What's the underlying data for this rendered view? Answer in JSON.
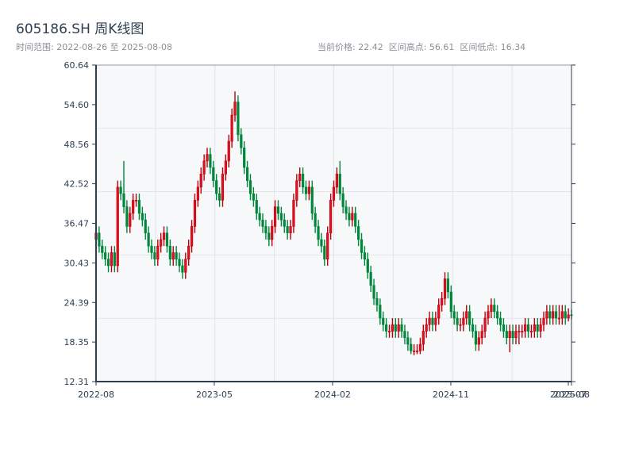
{
  "header": {
    "title": "605186.SH 周K线图",
    "range_label": "时间范围: 2022-08-26 至 2025-08-08",
    "current_price_label": "当前价格: 22.42",
    "high_label": "区间高点: 56.61",
    "low_label": "区间低点: 16.34"
  },
  "chart_data": {
    "type": "candlestick",
    "title": "605186.SH 周K线图",
    "frequency": "weekly",
    "date_range": [
      "2022-08-26",
      "2025-08-08"
    ],
    "ylim": [
      12.31,
      60.64
    ],
    "y_ticks": [
      "60.64",
      "54.60",
      "48.56",
      "42.52",
      "36.47",
      "30.43",
      "24.39",
      "18.35",
      "12.31"
    ],
    "x_ticks": [
      "2022-08",
      "2023-05",
      "2024-02",
      "2024-11",
      "2025-07",
      "2025-08"
    ],
    "grid": true,
    "colors": {
      "up": "#e3101e",
      "up_border": "#b8000d",
      "down": "#00873c",
      "background": "#f7f8fa",
      "axis": "#2d3e50",
      "grid": "#e1e4ea"
    },
    "open": [
      34,
      35,
      33,
      32,
      31,
      30,
      32,
      30,
      42,
      41,
      39,
      36,
      38,
      40,
      40,
      38,
      37,
      35,
      33,
      32,
      31,
      33,
      34,
      35,
      33,
      31,
      32,
      31,
      30,
      29,
      31,
      33,
      36,
      40,
      42,
      44,
      46,
      47,
      45,
      43,
      41,
      40,
      44,
      46,
      49,
      53,
      55,
      50,
      48,
      45,
      43,
      41,
      40,
      38,
      37,
      36,
      35,
      34,
      36,
      39,
      38,
      37,
      36,
      35,
      36,
      40,
      43,
      44,
      42,
      41,
      42,
      38,
      36,
      34,
      33,
      31,
      35,
      40,
      42,
      44,
      41,
      39,
      38,
      37,
      38,
      36,
      34,
      32,
      31,
      29,
      27,
      25,
      24,
      22,
      21,
      20,
      20,
      21,
      20,
      21,
      20,
      19,
      18,
      17,
      17,
      17,
      18,
      20,
      21,
      22,
      21,
      22,
      24,
      25,
      28,
      26,
      23,
      22,
      21,
      21,
      22,
      23,
      21,
      20,
      18,
      19,
      20,
      22,
      23,
      24,
      23,
      22,
      21,
      20,
      19,
      20,
      19,
      20,
      20,
      20,
      21,
      20,
      20,
      21,
      20,
      21,
      22,
      23,
      22,
      23,
      22,
      22,
      23,
      22,
      22.5
    ],
    "high": [
      36,
      36,
      34,
      33,
      32,
      33,
      33,
      43,
      43,
      46,
      40,
      39,
      41,
      41,
      41,
      39,
      38,
      36,
      34,
      33,
      34,
      35,
      36,
      36,
      34,
      33,
      33,
      32,
      31,
      32,
      34,
      37,
      41,
      43,
      45,
      47,
      48,
      48,
      46,
      44,
      42,
      45,
      47,
      50,
      54,
      56.61,
      56,
      51,
      49,
      46,
      44,
      42,
      41,
      39,
      38,
      37,
      36,
      37,
      40,
      40,
      39,
      38,
      37,
      37,
      41,
      44,
      45,
      45,
      43,
      43,
      43,
      39,
      37,
      35,
      34,
      36,
      41,
      43,
      45,
      46,
      42,
      40,
      39,
      39,
      39,
      37,
      35,
      33,
      32,
      30,
      28,
      26,
      25,
      23,
      22,
      21,
      22,
      22,
      22,
      22,
      21,
      20,
      19,
      18,
      18,
      19,
      21,
      22,
      23,
      23,
      23,
      25,
      26,
      29,
      29,
      27,
      24,
      23,
      22,
      23,
      24,
      24,
      22,
      21,
      20,
      21,
      23,
      24,
      25,
      25,
      24,
      23,
      22,
      21,
      21,
      21,
      21,
      21,
      21,
      22,
      22,
      21,
      22,
      22,
      22,
      23,
      24,
      24,
      24,
      24,
      24,
      24,
      24,
      23.5,
      23.3
    ],
    "low": [
      33,
      32,
      31,
      30,
      29,
      29,
      29,
      29,
      40,
      38,
      35,
      35,
      37,
      39,
      37,
      36,
      34,
      32,
      31,
      30,
      30,
      32,
      33,
      32,
      30,
      30,
      30,
      29,
      28,
      28,
      30,
      32,
      35,
      39,
      41,
      43,
      45,
      44,
      42,
      40,
      39,
      39,
      43,
      45,
      48,
      52,
      49,
      47,
      44,
      42,
      40,
      39,
      37,
      36,
      35,
      34,
      33,
      33,
      35,
      37,
      36,
      35,
      34,
      34,
      35,
      39,
      42,
      41,
      40,
      40,
      37,
      35,
      33,
      32,
      30,
      30,
      34,
      39,
      41,
      40,
      38,
      37,
      36,
      36,
      35,
      33,
      31,
      30,
      28,
      26,
      24,
      23,
      21,
      20,
      19,
      19,
      19,
      19,
      19,
      19,
      18,
      17,
      16.5,
      16.34,
      16.5,
      16.5,
      17,
      19,
      20,
      20,
      20,
      21,
      23,
      24,
      25,
      22,
      21,
      20,
      20,
      20,
      21,
      20,
      19,
      17,
      17,
      18,
      19,
      21,
      22,
      22,
      21,
      20,
      19,
      18,
      16.8,
      18,
      18,
      18,
      19,
      19,
      19,
      19,
      19,
      19,
      19,
      20,
      21,
      21,
      21,
      21,
      21,
      21,
      21,
      21.5,
      21.8
    ],
    "close": [
      35,
      33,
      32,
      31,
      30,
      32,
      30,
      42,
      41,
      39,
      36,
      38,
      40,
      40,
      38,
      37,
      35,
      33,
      32,
      31,
      33,
      34,
      35,
      33,
      31,
      32,
      31,
      30,
      29,
      31,
      33,
      36,
      40,
      42,
      44,
      46,
      47,
      45,
      43,
      41,
      40,
      44,
      46,
      49,
      53,
      55,
      50,
      48,
      45,
      43,
      41,
      40,
      38,
      37,
      36,
      35,
      34,
      36,
      39,
      38,
      37,
      36,
      35,
      36,
      40,
      43,
      44,
      42,
      41,
      42,
      38,
      36,
      34,
      33,
      31,
      35,
      40,
      42,
      44,
      41,
      39,
      38,
      37,
      38,
      36,
      34,
      32,
      31,
      29,
      27,
      25,
      24,
      22,
      21,
      20,
      20,
      21,
      20,
      21,
      20,
      19,
      18,
      17,
      17,
      17,
      18,
      20,
      21,
      22,
      21,
      22,
      24,
      25,
      28,
      26,
      23,
      22,
      21,
      21,
      22,
      23,
      21,
      20,
      18,
      19,
      20,
      22,
      23,
      24,
      23,
      22,
      21,
      20,
      19,
      20,
      19,
      20,
      20,
      20,
      21,
      20,
      20,
      21,
      20,
      21,
      22,
      23,
      22,
      23,
      22,
      22,
      23,
      22,
      22.5,
      22.42
    ]
  }
}
